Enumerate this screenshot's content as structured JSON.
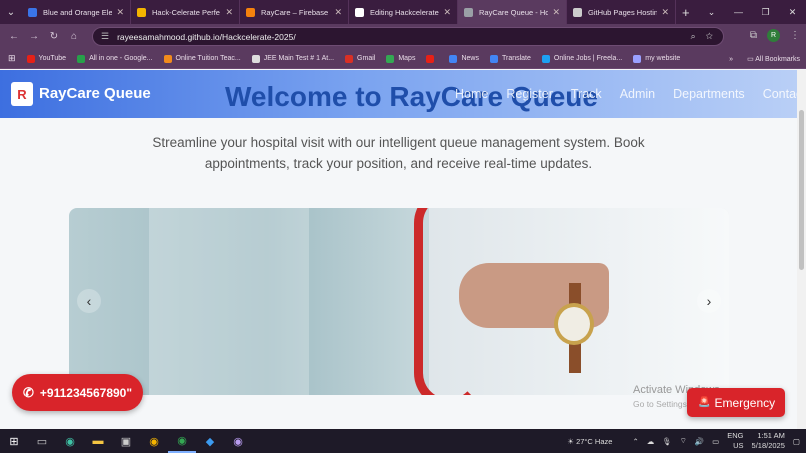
{
  "browser": {
    "tabs": [
      {
        "title": "Blue and Orange Ele",
        "color": "#3a74e8",
        "active": false
      },
      {
        "title": "Hack-Celerate Perfe",
        "color": "#f4b400",
        "active": false
      },
      {
        "title": "RayCare – Firebase c",
        "color": "#f5820d",
        "active": false
      },
      {
        "title": "Editing Hackcelerate",
        "color": "#ffffff",
        "active": false
      },
      {
        "title": "RayCare Queue - Hos",
        "color": "#9aa0a6",
        "active": true
      },
      {
        "title": "GitHub Pages Hostin",
        "color": "#cccccc",
        "active": false
      }
    ],
    "url": "rayeesamahmood.github.io/Hackcelerate-2025/",
    "profile_initial": "R",
    "bookmarks": [
      {
        "label": "YouTube",
        "color": "#e62117"
      },
      {
        "label": "All in one - Google...",
        "color": "#27a04a"
      },
      {
        "label": "Online Tuition Teac...",
        "color": "#f28b1c"
      },
      {
        "label": "JEE Main Test # 1 At...",
        "color": "#dddddd"
      },
      {
        "label": "Gmail",
        "color": "#d93025"
      },
      {
        "label": "Maps",
        "color": "#34a853"
      },
      {
        "label": "",
        "color": "#e62117"
      },
      {
        "label": "News",
        "color": "#4285f4"
      },
      {
        "label": "Translate",
        "color": "#4285f4"
      },
      {
        "label": "Online Jobs | Freela...",
        "color": "#1da1f2"
      },
      {
        "label": "my website",
        "color": "#9aa0ff"
      }
    ],
    "all_bookmarks": "All Bookmarks"
  },
  "page": {
    "brand": "RayCare Queue",
    "logo_letter": "R",
    "hero_title": "Welcome to RayCare Queue",
    "nav": [
      "Home",
      "Register",
      "Track",
      "Admin",
      "Departments",
      "Contact"
    ],
    "subtitle": "Streamline your hospital visit with our intelligent queue management system. Book appointments, track your position, and receive real-time updates.",
    "phone": "+911234567890\"",
    "emergency": "Emergency",
    "watermark_1": "Activate Windows",
    "watermark_2": "Go to Settings to"
  },
  "taskbar": {
    "weather": "27°C  Haze",
    "lang_1": "ENG",
    "lang_2": "US",
    "time": "1:51 AM",
    "date": "5/18/2025"
  }
}
